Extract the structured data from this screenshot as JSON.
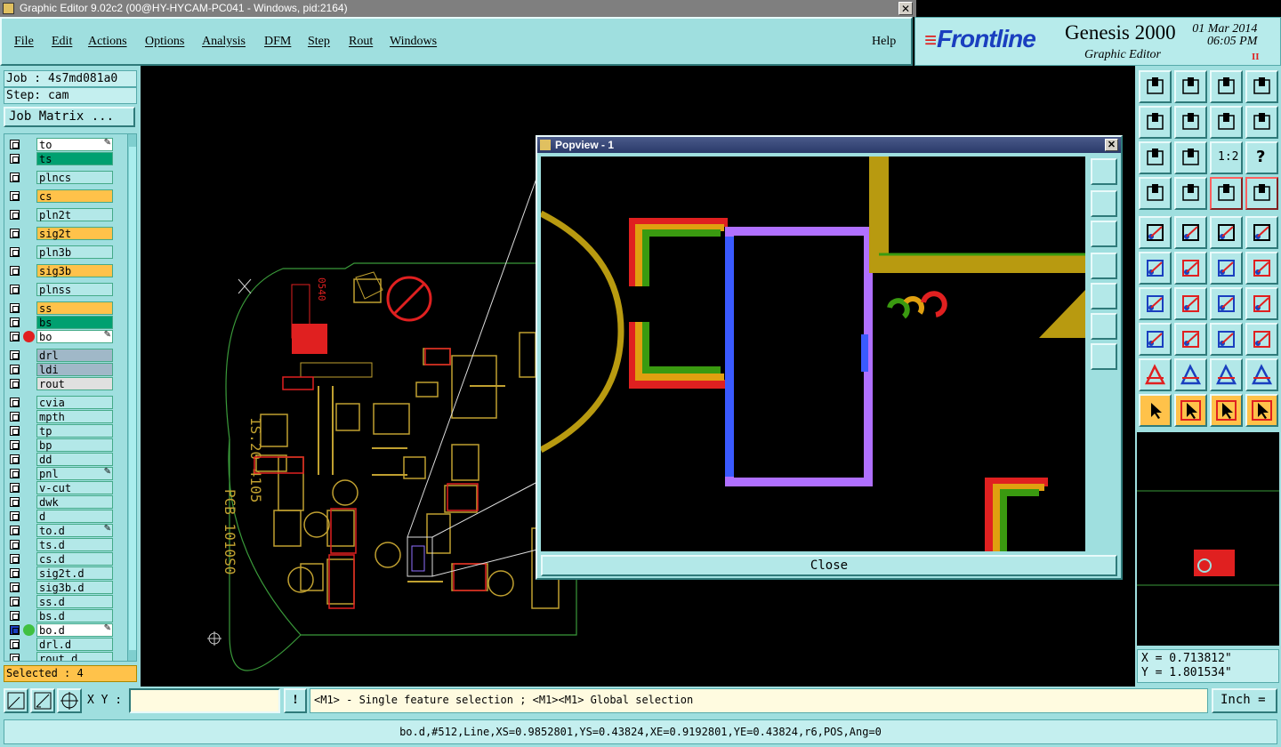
{
  "window": {
    "title": "Graphic Editor 9.02c2 (00@HY-HYCAM-PC041 - Windows, pid:2164)",
    "close_glyph": "✕"
  },
  "menu": {
    "items": [
      "File",
      "Edit",
      "Actions",
      "Options",
      "Analysis",
      "DFM",
      "Step",
      "Rout",
      "Windows"
    ],
    "help": "Help"
  },
  "brand": {
    "logo": "Frontline",
    "product": "Genesis 2000",
    "date": "01 Mar 2014",
    "time": "06:05 PM",
    "subtitle": "Graphic Editor",
    "pause_glyph": "II"
  },
  "job": {
    "job_label": "Job : 4s7md081a0",
    "step_label": "Step: cam",
    "matrix_button": "Job Matrix ..."
  },
  "layers": [
    {
      "name": "to",
      "color": "#ffffff",
      "edit": true
    },
    {
      "name": "ts",
      "color": "#00a070"
    },
    {
      "name": "plncs",
      "color": "#b3e8e8",
      "gap": true
    },
    {
      "name": "cs",
      "color": "#ffc24a",
      "gap": true
    },
    {
      "name": "pln2t",
      "color": "#b3e8e8",
      "gap": true
    },
    {
      "name": "sig2t",
      "color": "#ffc24a",
      "gap": true
    },
    {
      "name": "pln3b",
      "color": "#b3e8e8",
      "gap": true
    },
    {
      "name": "sig3b",
      "color": "#ffc24a",
      "gap": true
    },
    {
      "name": "plnss",
      "color": "#b3e8e8",
      "gap": true
    },
    {
      "name": "ss",
      "color": "#ffc24a",
      "gap": true
    },
    {
      "name": "bs",
      "color": "#00a070"
    },
    {
      "name": "bo",
      "color": "#ffffff",
      "edit": true,
      "dot": "#e02020"
    },
    {
      "name": "drl",
      "color": "#a0b8c8",
      "gap": true
    },
    {
      "name": "ldi",
      "color": "#a0b8c8"
    },
    {
      "name": "rout",
      "color": "#e0e0e0"
    },
    {
      "name": "cvia",
      "color": "#b3e8e8",
      "gap": true
    },
    {
      "name": "mpth",
      "color": "#b3e8e8"
    },
    {
      "name": "tp",
      "color": "#b3e8e8"
    },
    {
      "name": "bp",
      "color": "#b3e8e8"
    },
    {
      "name": "dd",
      "color": "#b3e8e8"
    },
    {
      "name": "pnl",
      "color": "#b3e8e8",
      "edit": true
    },
    {
      "name": "v-cut",
      "color": "#b3e8e8"
    },
    {
      "name": "dwk",
      "color": "#b3e8e8"
    },
    {
      "name": "d",
      "color": "#b3e8e8"
    },
    {
      "name": "to.d",
      "color": "#b3e8e8",
      "edit": true
    },
    {
      "name": "ts.d",
      "color": "#b3e8e8"
    },
    {
      "name": "cs.d",
      "color": "#b3e8e8"
    },
    {
      "name": "sig2t.d",
      "color": "#b3e8e8"
    },
    {
      "name": "sig3b.d",
      "color": "#b3e8e8"
    },
    {
      "name": "ss.d",
      "color": "#b3e8e8"
    },
    {
      "name": "bs.d",
      "color": "#b3e8e8"
    },
    {
      "name": "bo.d",
      "color": "#ffffff",
      "edit": true,
      "dot": "#40c040",
      "active": true
    },
    {
      "name": "drl.d",
      "color": "#b3e8e8"
    },
    {
      "name": "rout.d",
      "color": "#b3e8e8"
    }
  ],
  "selected": "Selected : 4",
  "canvas": {
    "board_text_1": "PCB 1010S0",
    "board_text_2": "1S.20 4105",
    "board_text_3": "0540"
  },
  "popview": {
    "title": "Popview - 1",
    "close_button": "Close",
    "close_glyph": "✕"
  },
  "coords": {
    "x": "X = 0.713812\"",
    "y": "Y = 1.801534\""
  },
  "bottom": {
    "xy_label": "X Y :",
    "xy_value": "",
    "excl": "!",
    "hint": "<M1> - Single feature selection ; <M1><M1> Global selection",
    "units": "Inch ="
  },
  "status": "bo.d,#512,Line,XS=0.9852801,YS=0.43824,XE=0.9192801,YE=0.43824,r6,POS,Ang=0",
  "tool_labels": {
    "ratio": "1:2",
    "help": "?"
  }
}
